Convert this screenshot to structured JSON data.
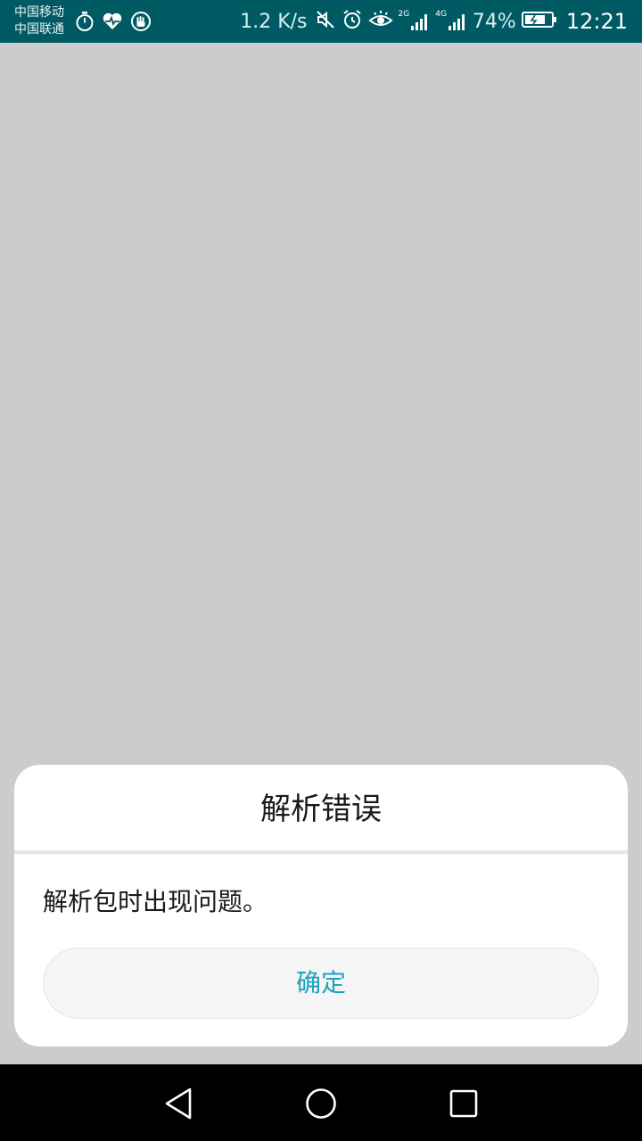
{
  "status_bar": {
    "carrier_1": "中国移动",
    "carrier_2": "中国联通",
    "net_speed": "1.2 K/s",
    "sim1_network": "2G",
    "sim2_network": "4G",
    "battery_percent": "74%",
    "time": "12:21",
    "left_icons": [
      "stopwatch-icon",
      "heart-rate-icon",
      "hand-icon"
    ],
    "right_icons": [
      "mute-icon",
      "alarm-icon",
      "eye-comfort-icon",
      "signal-icon",
      "signal-icon",
      "battery-charging-icon"
    ],
    "background_color": "#005a64"
  },
  "dialog": {
    "title": "解析错误",
    "message": "解析包时出现问题。",
    "confirm_label": "确定",
    "accent_color": "#1aa3be"
  },
  "nav_bar": {
    "icons": [
      "back-icon",
      "home-icon",
      "recents-icon"
    ]
  }
}
